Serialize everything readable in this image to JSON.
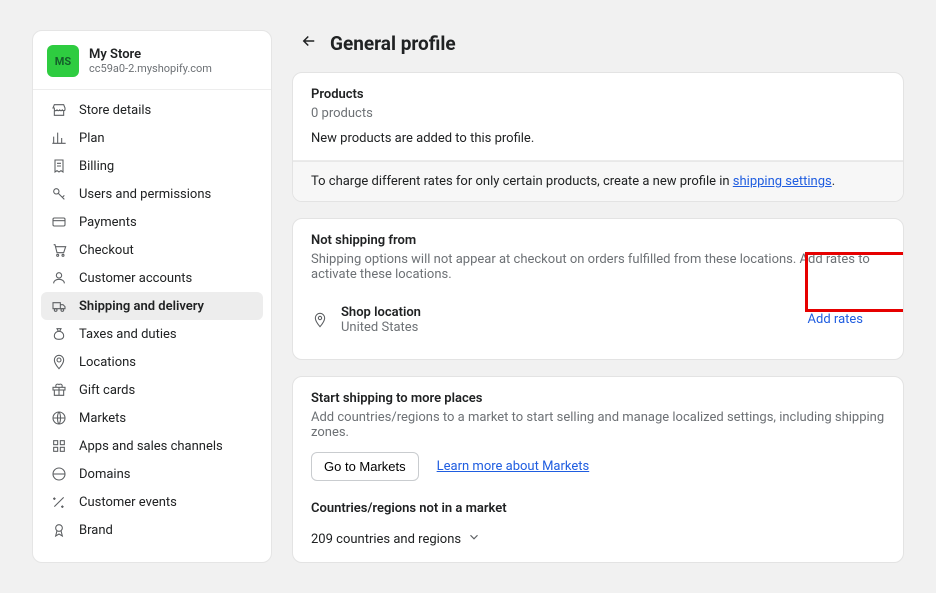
{
  "store": {
    "avatar_text": "MS",
    "name": "My Store",
    "domain": "cc59a0-2.myshopify.com"
  },
  "nav": {
    "items": [
      {
        "label": "Store details"
      },
      {
        "label": "Plan"
      },
      {
        "label": "Billing"
      },
      {
        "label": "Users and permissions"
      },
      {
        "label": "Payments"
      },
      {
        "label": "Checkout"
      },
      {
        "label": "Customer accounts"
      },
      {
        "label": "Shipping and delivery"
      },
      {
        "label": "Taxes and duties"
      },
      {
        "label": "Locations"
      },
      {
        "label": "Gift cards"
      },
      {
        "label": "Markets"
      },
      {
        "label": "Apps and sales channels"
      },
      {
        "label": "Domains"
      },
      {
        "label": "Customer events"
      },
      {
        "label": "Brand"
      }
    ]
  },
  "header": {
    "title": "General profile"
  },
  "products_card": {
    "title": "Products",
    "count_text": "0 products",
    "desc": "New products are added to this profile.",
    "banner_pre": "To charge different rates for only certain products, create a new profile in ",
    "banner_link": "shipping settings",
    "banner_post": "."
  },
  "not_shipping_card": {
    "title": "Not shipping from",
    "desc": "Shipping options will not appear at checkout on orders fulfilled from these locations. Add rates to activate these locations.",
    "loc_title": "Shop location",
    "loc_sub": "United States",
    "add_rates": "Add rates"
  },
  "markets_card": {
    "title": "Start shipping to more places",
    "desc": "Add countries/regions to a market to start selling and manage localized settings, including shipping zones.",
    "go_btn": "Go to Markets",
    "learn_link": "Learn more about Markets",
    "countries_title": "Countries/regions not in a market",
    "countries_text": "209 countries and regions"
  }
}
